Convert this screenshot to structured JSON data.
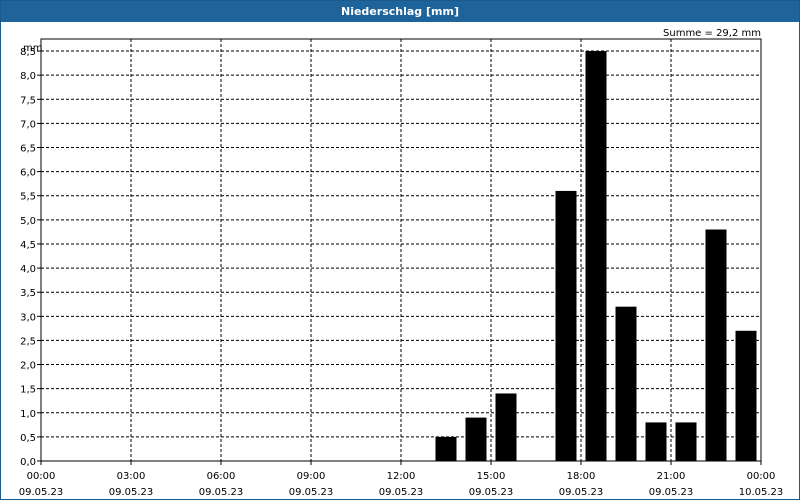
{
  "chart_data": {
    "type": "bar",
    "title": "Niederschlag [mm]",
    "ylabel": "mm",
    "annotation": "Summe = 29,2 mm",
    "ylim": [
      0,
      8.75
    ],
    "y_ticks": [
      "0,0",
      "0,5",
      "1,0",
      "1,5",
      "2,0",
      "2,5",
      "3,0",
      "3,5",
      "4,0",
      "4,5",
      "5,0",
      "5,5",
      "6,0",
      "6,5",
      "7,0",
      "7,5",
      "8,0",
      "8,5"
    ],
    "x_ticks": [
      {
        "time": "00:00",
        "date": "09.05.23"
      },
      {
        "time": "03:00",
        "date": "09.05.23"
      },
      {
        "time": "06:00",
        "date": "09.05.23"
      },
      {
        "time": "09:00",
        "date": "09.05.23"
      },
      {
        "time": "12:00",
        "date": "09.05.23"
      },
      {
        "time": "15:00",
        "date": "09.05.23"
      },
      {
        "time": "18:00",
        "date": "09.05.23"
      },
      {
        "time": "21:00",
        "date": "09.05.23"
      },
      {
        "time": "00:00",
        "date": "10.05.23"
      }
    ],
    "x_hours": [
      13.5,
      14.5,
      15.5,
      17.5,
      18.5,
      19.5,
      20.5,
      21.5,
      22.5,
      23.5
    ],
    "values": [
      0.5,
      0.9,
      1.4,
      5.6,
      8.5,
      3.2,
      0.8,
      0.8,
      4.8,
      2.7
    ],
    "grid": true,
    "bar_color": "#000000"
  }
}
